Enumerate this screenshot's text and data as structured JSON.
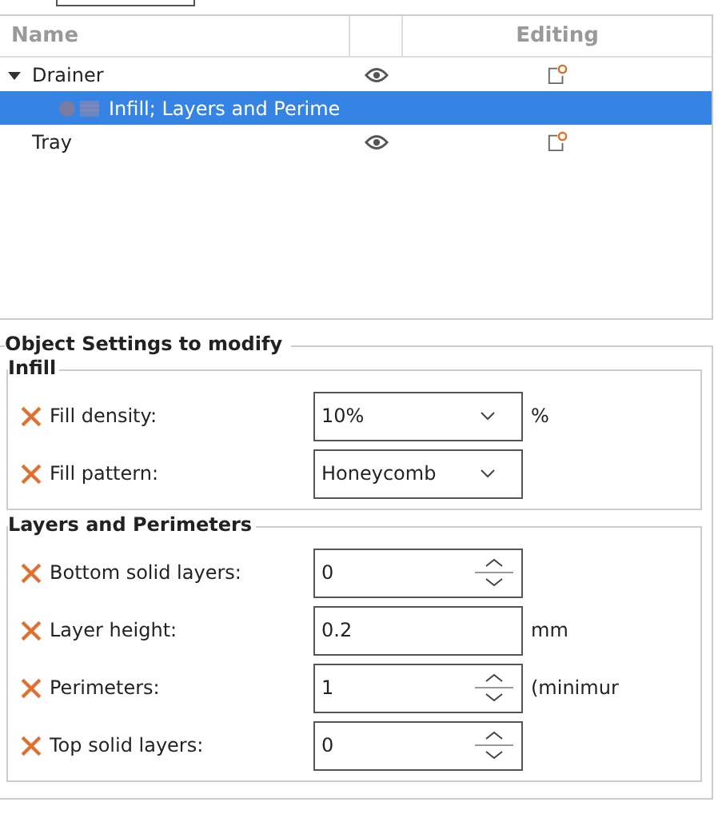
{
  "tree": {
    "columns": [
      "Name",
      "",
      "Editing"
    ],
    "items": [
      {
        "label": "Drainer",
        "expanded": true,
        "selected": false,
        "visible": true,
        "editable": true,
        "children": [
          {
            "label": "Infill; Layers and Perime",
            "selected": true,
            "visible": false,
            "editable": false
          }
        ]
      },
      {
        "label": "Tray",
        "selected": false,
        "visible": true,
        "editable": true
      }
    ]
  },
  "settings": {
    "title": "Object Settings to modify",
    "groups": [
      {
        "title": "Infill",
        "options": [
          {
            "label": "Fill density:",
            "kind": "combo",
            "value": "10%",
            "unit": "%"
          },
          {
            "label": "Fill pattern:",
            "kind": "combo",
            "value": "Honeycomb"
          }
        ]
      },
      {
        "title": "Layers and Perimeters",
        "options": [
          {
            "label": "Bottom solid layers:",
            "kind": "spin",
            "value": "0"
          },
          {
            "label": "Layer height:",
            "kind": "text",
            "value": "0.2",
            "unit": "mm"
          },
          {
            "label": "Perimeters:",
            "kind": "spin",
            "value": "1",
            "unit": "(minimur"
          },
          {
            "label": "Top solid layers:",
            "kind": "spin",
            "value": "0"
          }
        ]
      }
    ]
  }
}
